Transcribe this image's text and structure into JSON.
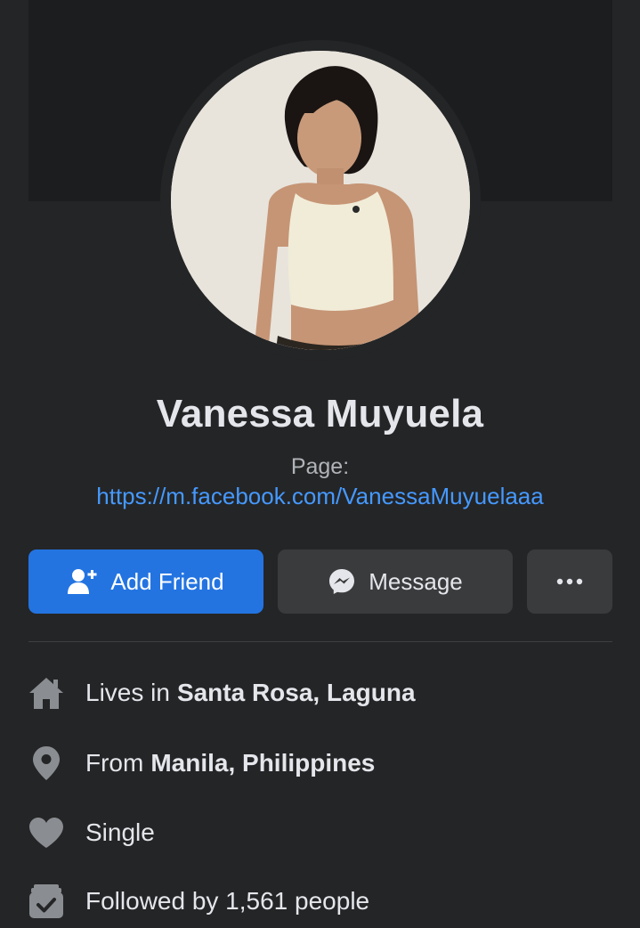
{
  "profile": {
    "name": "Vanessa Muyuela",
    "page_label": "Page:",
    "page_url": "https://m.facebook.com/VanessaMuyuelaaa"
  },
  "actions": {
    "add_friend_label": "Add Friend",
    "message_label": "Message",
    "more_icon": "more-horizontal-icon"
  },
  "intro": {
    "lives_prefix": "Lives in",
    "lives_place": "Santa Rosa, Laguna",
    "from_prefix": "From",
    "from_place": "Manila, Philippines",
    "relationship": "Single",
    "followed_by": "Followed by 1,561 people"
  },
  "colors": {
    "background": "#242526",
    "primary_button": "#2374e1",
    "secondary_button": "#3a3b3c",
    "link": "#4599ff"
  }
}
